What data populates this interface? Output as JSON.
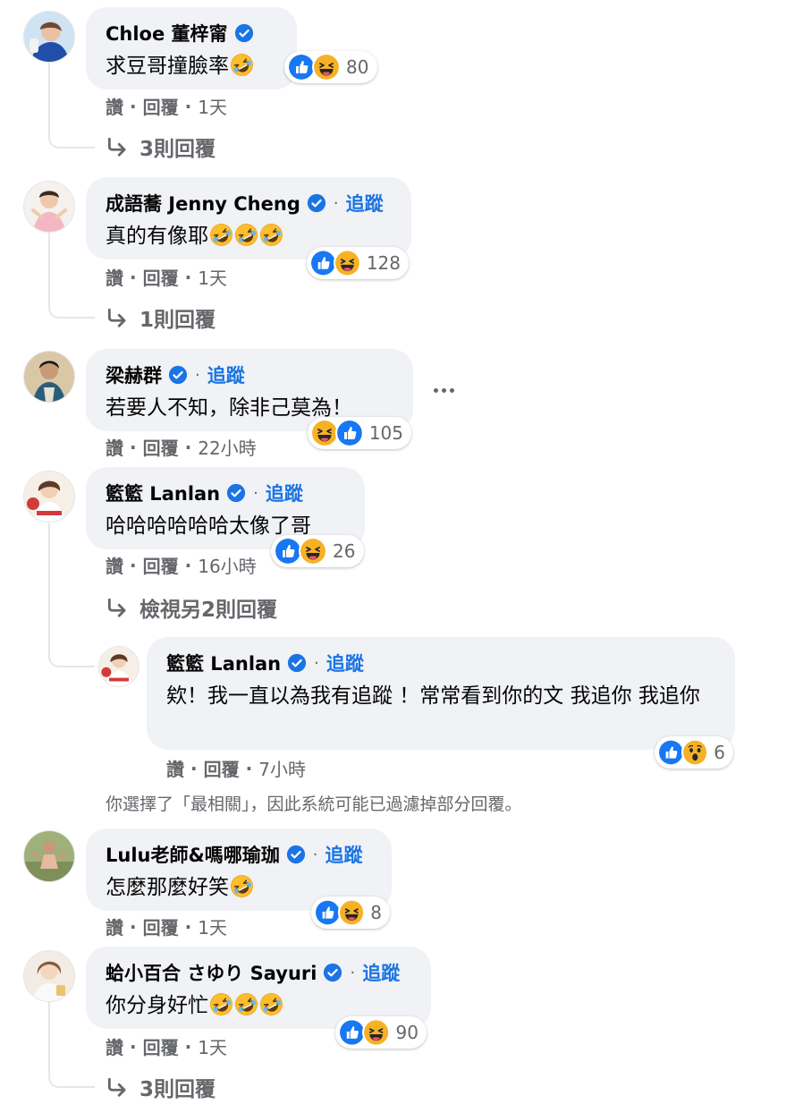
{
  "colors": {
    "bubble": "#f0f2f5",
    "link_blue": "#1b74e4",
    "secondary_text": "#65676b",
    "like_blue": "#1877f2",
    "haha_yellow": "#f7b125"
  },
  "comments": [
    {
      "name": "Chloe 董梓甯",
      "text": "求豆哥撞臉率",
      "emoji_count": 1,
      "reactions": [
        "like-icon",
        "haha-icon"
      ],
      "reaction_count": "80",
      "like": "讚",
      "reply": "回覆",
      "time": "1天",
      "replies_label": "3則回覆"
    },
    {
      "name": "成語蕎 Jenny Cheng",
      "follow": "追蹤",
      "text": "真的有像耶",
      "emoji_count": 3,
      "reactions": [
        "like-icon",
        "haha-icon"
      ],
      "reaction_count": "128",
      "like": "讚",
      "reply": "回覆",
      "time": "1天",
      "replies_label": "1則回覆"
    },
    {
      "name": "梁赫群",
      "follow": "追蹤",
      "text": "若要人不知，除非己莫為！",
      "reactions": [
        "haha-icon",
        "like-icon"
      ],
      "reaction_count": "105",
      "like": "讚",
      "reply": "回覆",
      "time": "22小時"
    },
    {
      "name": "籃籃 Lanlan",
      "follow": "追蹤",
      "text": "哈哈哈哈哈哈太像了哥",
      "reactions": [
        "like-icon",
        "haha-icon"
      ],
      "reaction_count": "26",
      "like": "讚",
      "reply": "回覆",
      "time": "16小時",
      "replies_label": "檢視另2則回覆",
      "reply_item": {
        "name": "籃籃 Lanlan",
        "follow": "追蹤",
        "text": "欸！我一直以為我有追蹤 ！常常看到你的文 我追你 我追你",
        "reactions": [
          "like-icon",
          "wow-icon"
        ],
        "reaction_count": "6",
        "like": "讚",
        "reply": "回覆",
        "time": "7小時"
      }
    },
    {
      "name": "Lulu老師&嗎哪瑜珈",
      "follow": "追蹤",
      "text": "怎麼那麼好笑",
      "emoji_count": 1,
      "reactions": [
        "like-icon",
        "haha-icon"
      ],
      "reaction_count": "8",
      "like": "讚",
      "reply": "回覆",
      "time": "1天"
    },
    {
      "name": "蛤小百合 さゆり Sayuri",
      "follow": "追蹤",
      "text": "你分身好忙",
      "emoji_count": 3,
      "reactions": [
        "like-icon",
        "haha-icon"
      ],
      "reaction_count": "90",
      "like": "讚",
      "reply": "回覆",
      "time": "1天",
      "replies_label": "3則回覆"
    }
  ],
  "filter_note": "你選擇了「最相關」，因此系統可能已過濾掉部分回覆。",
  "separator": "·"
}
